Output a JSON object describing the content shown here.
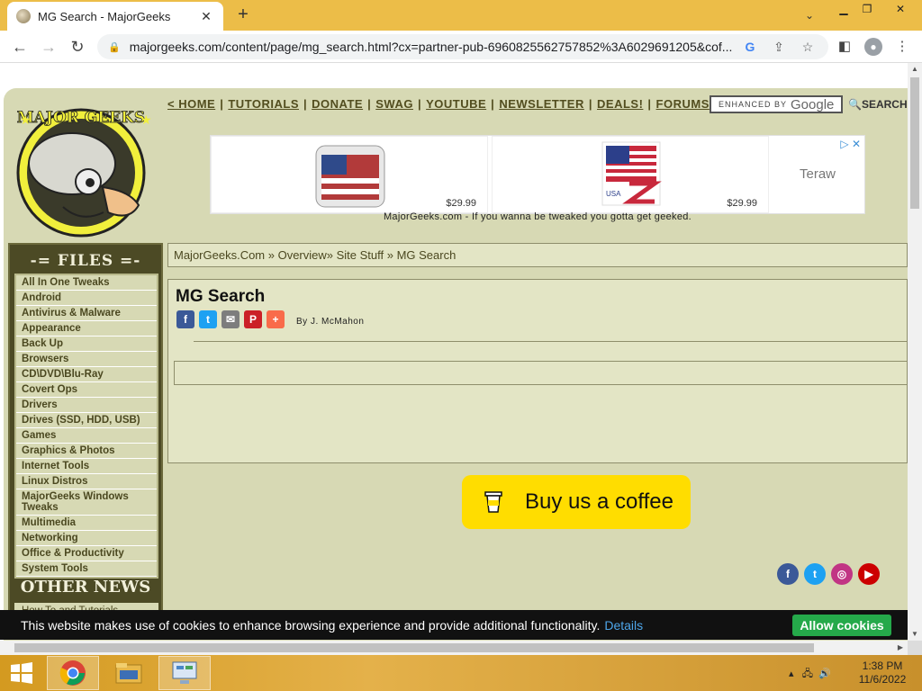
{
  "browser": {
    "tab_title": "MG Search - MajorGeeks",
    "url": "majorgeeks.com/content/page/mg_search.html?cx=partner-pub-6960825562757852%3A6029691205&cof..."
  },
  "site": {
    "logo_text": "MAJOR GEEKS .COM",
    "nav": [
      "< HOME",
      "TUTORIALS",
      "DONATE",
      "SWAG",
      "YOUTUBE",
      "NEWSLETTER",
      "DEALS!",
      "FORUMS"
    ],
    "search_label": "ENHANCED BY",
    "search_brand": "Google",
    "search_button": "SEARCH",
    "tagline": "MajorGeeks.com - If you wanna be tweaked you gotta get geeked."
  },
  "ad": {
    "price1": "$29.99",
    "price2": "$29.99",
    "teraw": "Teraw",
    "flag_text": "USA"
  },
  "sidebar": {
    "files_title": "-= FILES =-",
    "files": [
      "All In One Tweaks",
      "Android",
      "Antivirus & Malware",
      "Appearance",
      "Back Up",
      "Browsers",
      "CD\\DVD\\Blu-Ray",
      "Covert Ops",
      "Drivers",
      "Drives (SSD, HDD, USB)",
      "Games",
      "Graphics & Photos",
      "Internet Tools",
      "Linux Distros",
      "MajorGeeks Windows Tweaks",
      "Multimedia",
      "Networking",
      "Office & Productivity",
      "System Tools"
    ],
    "news_title": "OTHER NEWS",
    "news_first": "How To and Tutorials"
  },
  "main": {
    "breadcrumb": "MajorGeeks.Com » Overview» Site Stuff » MG Search",
    "title": "MG Search",
    "byline": "By J. McMahon",
    "coffee": "Buy us a coffee"
  },
  "cookie": {
    "message": "This website makes use of cookies to enhance browsing experience and provide additional functionality.",
    "details": "Details",
    "allow": "Allow cookies"
  },
  "taskbar": {
    "time": "1:38 PM",
    "date": "11/6/2022"
  }
}
